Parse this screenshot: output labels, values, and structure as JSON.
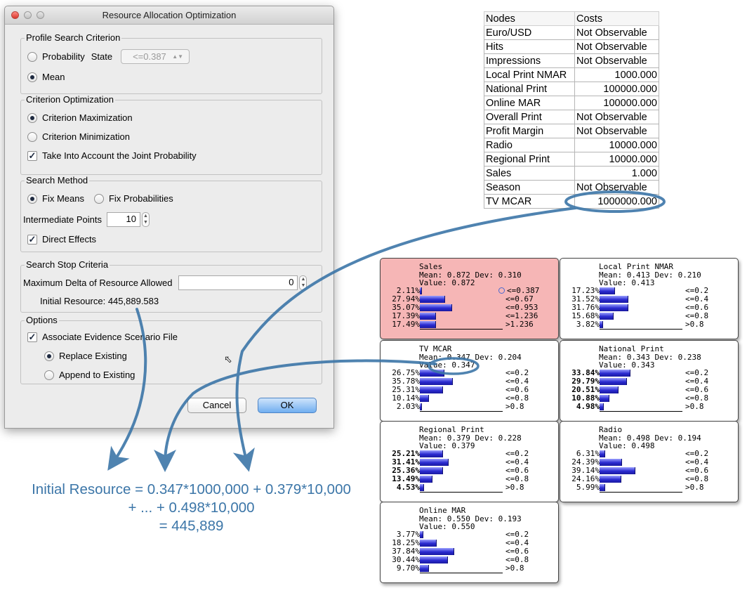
{
  "dialog": {
    "title": "Resource Allocation Optimization",
    "profile": {
      "legend": "Profile Search Criterion",
      "probability": "Probability",
      "state_label": "State",
      "state_value": "<=0.387",
      "mean": "Mean"
    },
    "criterion": {
      "legend": "Criterion Optimization",
      "max": "Criterion Maximization",
      "min": "Criterion Minimization",
      "joint": "Take Into Account the Joint Probability"
    },
    "method": {
      "legend": "Search Method",
      "fix_means": "Fix Means",
      "fix_probs": "Fix Probabilities",
      "points_label": "Intermediate Points",
      "points_value": "10",
      "direct": "Direct Effects"
    },
    "stop": {
      "legend": "Search Stop Criteria",
      "delta_label": "Maximum Delta of Resource Allowed",
      "delta_value": "0",
      "initial": "Initial Resource: 445,889.583"
    },
    "options": {
      "legend": "Options",
      "assoc": "Associate Evidence Scenario File",
      "replace": "Replace Existing",
      "append": "Append to Existing"
    },
    "cancel": "Cancel",
    "ok": "OK"
  },
  "costs": {
    "headers": [
      "Nodes",
      "Costs"
    ],
    "rows": [
      [
        "Euro/USD",
        "Not Observable"
      ],
      [
        "Hits",
        "Not Observable"
      ],
      [
        "Impressions",
        "Not Observable"
      ],
      [
        "Local Print NMAR",
        "1000.000"
      ],
      [
        "National Print",
        "100000.000"
      ],
      [
        "Online MAR",
        "100000.000"
      ],
      [
        "Overall Print",
        "Not Observable"
      ],
      [
        "Profit Margin",
        "Not Observable"
      ],
      [
        "Radio",
        "10000.000"
      ],
      [
        "Regional Print",
        "10000.000"
      ],
      [
        "Sales",
        "1.000"
      ],
      [
        "Season",
        "Not Observable"
      ],
      [
        "TV MCAR",
        "1000000.000"
      ]
    ]
  },
  "monitors": [
    {
      "title": "Sales",
      "stats": "Mean: 0.872 Dev: 0.310",
      "value": "Value: 0.872",
      "red": true,
      "rows": [
        {
          "pct": "2.11%",
          "v": 2.11,
          "label": "<=0.387",
          "mark": true
        },
        {
          "pct": "27.94%",
          "v": 27.94,
          "label": "<=0.67"
        },
        {
          "pct": "35.07%",
          "v": 35.07,
          "label": "<=0.953"
        },
        {
          "pct": "17.39%",
          "v": 17.39,
          "label": "<=1.236"
        },
        {
          "pct": "17.49%",
          "v": 17.49,
          "label": ">1.236"
        }
      ]
    },
    {
      "title": "Local Print NMAR",
      "stats": "Mean: 0.413 Dev: 0.210",
      "value": "Value: 0.413",
      "rows": [
        {
          "pct": "17.23%",
          "v": 17.23,
          "label": "<=0.2"
        },
        {
          "pct": "31.52%",
          "v": 31.52,
          "label": "<=0.4"
        },
        {
          "pct": "31.76%",
          "v": 31.76,
          "label": "<=0.6"
        },
        {
          "pct": "15.68%",
          "v": 15.68,
          "label": "<=0.8"
        },
        {
          "pct": "3.82%",
          "v": 3.82,
          "label": ">0.8"
        }
      ]
    },
    {
      "title": "TV MCAR",
      "stats": "Mean: 0.347 Dev: 0.204",
      "value": "Value: 0.347",
      "rows": [
        {
          "pct": "26.75%",
          "v": 26.75,
          "label": "<=0.2"
        },
        {
          "pct": "35.78%",
          "v": 35.78,
          "label": "<=0.4"
        },
        {
          "pct": "25.31%",
          "v": 25.31,
          "label": "<=0.6"
        },
        {
          "pct": "10.14%",
          "v": 10.14,
          "label": "<=0.8"
        },
        {
          "pct": "2.03%",
          "v": 2.03,
          "label": ">0.8"
        }
      ]
    },
    {
      "title": "National Print",
      "stats": "Mean: 0.343 Dev: 0.238",
      "value": "Value: 0.343",
      "bold": true,
      "rows": [
        {
          "pct": "33.84%",
          "v": 33.84,
          "label": "<=0.2"
        },
        {
          "pct": "29.79%",
          "v": 29.79,
          "label": "<=0.4"
        },
        {
          "pct": "20.51%",
          "v": 20.51,
          "label": "<=0.6"
        },
        {
          "pct": "10.88%",
          "v": 10.88,
          "label": "<=0.8"
        },
        {
          "pct": "4.98%",
          "v": 4.98,
          "label": ">0.8"
        }
      ]
    },
    {
      "title": "Regional Print",
      "stats": "Mean: 0.379 Dev: 0.228",
      "value": "Value: 0.379",
      "bold": true,
      "rows": [
        {
          "pct": "25.21%",
          "v": 25.21,
          "label": "<=0.2"
        },
        {
          "pct": "31.41%",
          "v": 31.41,
          "label": "<=0.4"
        },
        {
          "pct": "25.36%",
          "v": 25.36,
          "label": "<=0.6"
        },
        {
          "pct": "13.49%",
          "v": 13.49,
          "label": "<=0.8"
        },
        {
          "pct": "4.53%",
          "v": 4.53,
          "label": ">0.8"
        }
      ]
    },
    {
      "title": "Radio",
      "stats": "Mean: 0.498 Dev: 0.194",
      "value": "Value: 0.498",
      "rows": [
        {
          "pct": "6.31%",
          "v": 6.31,
          "label": "<=0.2"
        },
        {
          "pct": "24.39%",
          "v": 24.39,
          "label": "<=0.4"
        },
        {
          "pct": "39.14%",
          "v": 39.14,
          "label": "<=0.6"
        },
        {
          "pct": "24.16%",
          "v": 24.16,
          "label": "<=0.8"
        },
        {
          "pct": "5.99%",
          "v": 5.99,
          "label": ">0.8"
        }
      ]
    },
    {
      "title": "Online MAR",
      "stats": "Mean: 0.550 Dev: 0.193",
      "value": "Value: 0.550",
      "rows": [
        {
          "pct": "3.77%",
          "v": 3.77,
          "label": "<=0.2"
        },
        {
          "pct": "18.25%",
          "v": 18.25,
          "label": "<=0.4"
        },
        {
          "pct": "37.84%",
          "v": 37.84,
          "label": "<=0.6"
        },
        {
          "pct": "30.44%",
          "v": 30.44,
          "label": "<=0.8"
        },
        {
          "pct": "9.70%",
          "v": 9.7,
          "label": ">0.8"
        }
      ]
    }
  ],
  "equation": {
    "line1": "Initial Resource = 0.347*1000,000 + 0.379*10,000",
    "line2": "+ ... + 0.498*10,000",
    "line3": "= 445,889"
  },
  "colors": {
    "annotation": "#3c76a8",
    "bar": "#2a2ad0",
    "highlight": "#f6b6b6"
  }
}
